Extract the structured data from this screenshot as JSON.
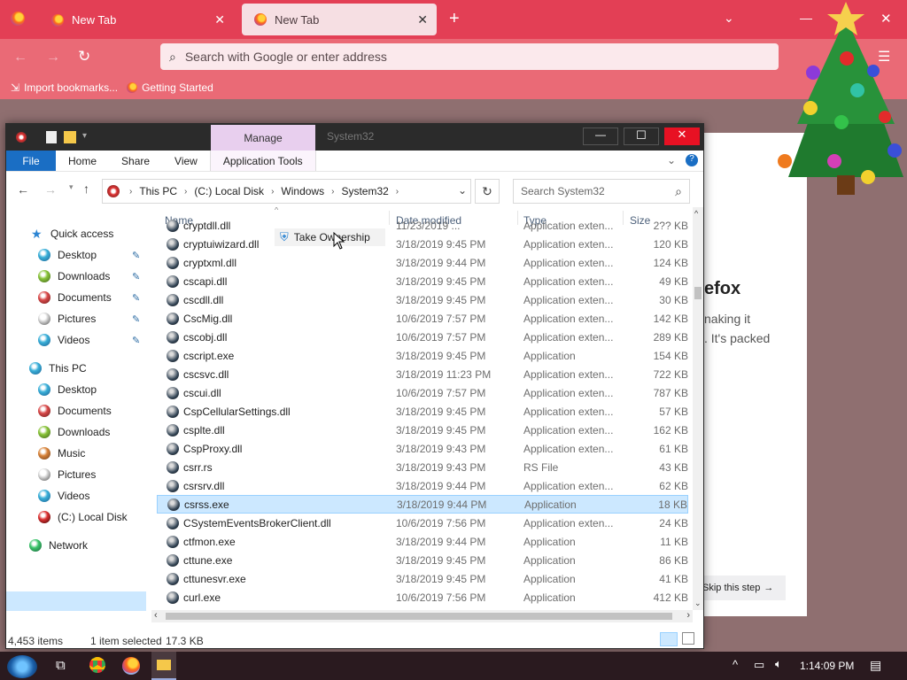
{
  "firefox": {
    "tabs": [
      {
        "label": "New Tab",
        "active": false
      },
      {
        "label": "New Tab",
        "active": true
      }
    ],
    "urlbar_placeholder": "Search with Google or enter address",
    "bookmarks": [
      "Import bookmarks...",
      "Getting Started"
    ],
    "content": {
      "heading_fragment": "efox",
      "line1": "naking it",
      "line2": ". It's packed",
      "skip_label": "Skip this step"
    }
  },
  "explorer": {
    "title": "System32",
    "manage_tab": "Manage",
    "ribbon_tabs": [
      "File",
      "Home",
      "Share",
      "View",
      "Application Tools"
    ],
    "breadcrumb": [
      "This PC",
      "(C:) Local Disk",
      "Windows",
      "System32"
    ],
    "search_placeholder": "Search System32",
    "columns": {
      "name": "Name",
      "date": "Date modified",
      "type": "Type",
      "size": "Size"
    },
    "nav": {
      "quick_access": "Quick access",
      "quick_items": [
        "Desktop",
        "Downloads",
        "Documents",
        "Pictures",
        "Videos"
      ],
      "this_pc": "This PC",
      "pc_items": [
        "Desktop",
        "Documents",
        "Downloads",
        "Music",
        "Pictures",
        "Videos",
        "(C:) Local Disk"
      ],
      "network": "Network"
    },
    "context_item": "Take Ownership",
    "files": [
      {
        "name": "cryptdll.dll",
        "date": "11/23/2019 ...",
        "type": "Application exten...",
        "size": "2?? KB"
      },
      {
        "name": "cryptuiwizard.dll",
        "date": "3/18/2019 9:45 PM",
        "type": "Application exten...",
        "size": "120 KB"
      },
      {
        "name": "cryptxml.dll",
        "date": "3/18/2019 9:44 PM",
        "type": "Application exten...",
        "size": "124 KB"
      },
      {
        "name": "cscapi.dll",
        "date": "3/18/2019 9:45 PM",
        "type": "Application exten...",
        "size": "49 KB"
      },
      {
        "name": "cscdll.dll",
        "date": "3/18/2019 9:45 PM",
        "type": "Application exten...",
        "size": "30 KB"
      },
      {
        "name": "CscMig.dll",
        "date": "10/6/2019 7:57 PM",
        "type": "Application exten...",
        "size": "142 KB"
      },
      {
        "name": "cscobj.dll",
        "date": "10/6/2019 7:57 PM",
        "type": "Application exten...",
        "size": "289 KB"
      },
      {
        "name": "cscript.exe",
        "date": "3/18/2019 9:45 PM",
        "type": "Application",
        "size": "154 KB"
      },
      {
        "name": "cscsvc.dll",
        "date": "3/18/2019 11:23 PM",
        "type": "Application exten...",
        "size": "722 KB"
      },
      {
        "name": "cscui.dll",
        "date": "10/6/2019 7:57 PM",
        "type": "Application exten...",
        "size": "787 KB"
      },
      {
        "name": "CspCellularSettings.dll",
        "date": "3/18/2019 9:45 PM",
        "type": "Application exten...",
        "size": "57 KB"
      },
      {
        "name": "csplte.dll",
        "date": "3/18/2019 9:45 PM",
        "type": "Application exten...",
        "size": "162 KB"
      },
      {
        "name": "CspProxy.dll",
        "date": "3/18/2019 9:43 PM",
        "type": "Application exten...",
        "size": "61 KB"
      },
      {
        "name": "csrr.rs",
        "date": "3/18/2019 9:43 PM",
        "type": "RS File",
        "size": "43 KB"
      },
      {
        "name": "csrsrv.dll",
        "date": "3/18/2019 9:44 PM",
        "type": "Application exten...",
        "size": "62 KB"
      },
      {
        "name": "csrss.exe",
        "date": "3/18/2019 9:44 PM",
        "type": "Application",
        "size": "18 KB"
      },
      {
        "name": "CSystemEventsBrokerClient.dll",
        "date": "10/6/2019 7:56 PM",
        "type": "Application exten...",
        "size": "24 KB"
      },
      {
        "name": "ctfmon.exe",
        "date": "3/18/2019 9:44 PM",
        "type": "Application",
        "size": "11 KB"
      },
      {
        "name": "cttune.exe",
        "date": "3/18/2019 9:45 PM",
        "type": "Application",
        "size": "86 KB"
      },
      {
        "name": "cttunesvr.exe",
        "date": "3/18/2019 9:45 PM",
        "type": "Application",
        "size": "41 KB"
      },
      {
        "name": "curl.exe",
        "date": "10/6/2019 7:56 PM",
        "type": "Application",
        "size": "412 KB"
      }
    ],
    "selected_row": 15,
    "status": {
      "count": "4,453 items",
      "selected": "1 item selected",
      "size": "17.3 KB"
    }
  },
  "taskbar": {
    "time": "1:14:09 PM"
  }
}
